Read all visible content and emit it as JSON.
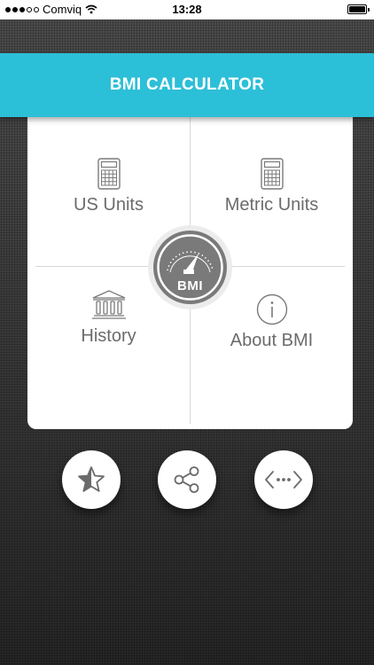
{
  "status_bar": {
    "carrier": "Comviq",
    "time": "13:28"
  },
  "header": {
    "title": "BMI CALCULATOR"
  },
  "menu": {
    "us_units": "US Units",
    "metric_units": "Metric Units",
    "history": "History",
    "about": "About BMI"
  },
  "badge": {
    "label": "BMI"
  },
  "actions": [
    {
      "icon": "star-half-icon"
    },
    {
      "icon": "share-icon"
    },
    {
      "icon": "code-icon"
    }
  ],
  "colors": {
    "accent": "#2cbfd8",
    "icon_gray": "#7a7a7a"
  }
}
